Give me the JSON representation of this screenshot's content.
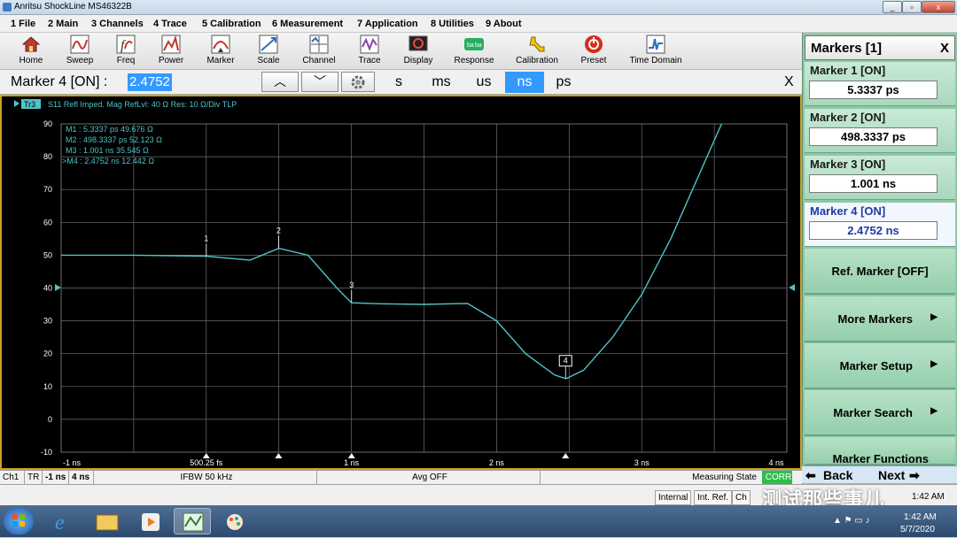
{
  "window": {
    "title": "Anritsu ShockLine MS46322B",
    "min": "_",
    "max": "▫",
    "close": "x"
  },
  "menu": [
    "1 File",
    "2 Main",
    "3 Channels",
    "4 Trace",
    "5 Calibration",
    "6 Measurement",
    "7 Application",
    "8 Utilities",
    "9 About"
  ],
  "toolbar": [
    {
      "label": "Home",
      "icon": "home-icon"
    },
    {
      "label": "Sweep",
      "icon": "sweep-icon"
    },
    {
      "label": "Freq",
      "icon": "frequency-icon"
    },
    {
      "label": "Power",
      "icon": "power-icon"
    },
    {
      "label": "Marker",
      "icon": "marker-icon"
    },
    {
      "label": "Scale",
      "icon": "scale-icon"
    },
    {
      "label": "Channel",
      "icon": "channel-icon"
    },
    {
      "label": "Trace",
      "icon": "trace-icon"
    },
    {
      "label": "Display",
      "icon": "display-icon"
    },
    {
      "label": "Response",
      "icon": "response-icon"
    },
    {
      "label": "Calibration",
      "icon": "calibration-icon"
    },
    {
      "label": "Preset",
      "icon": "preset-icon"
    },
    {
      "label": "Time Domain",
      "icon": "time-domain-icon"
    }
  ],
  "entry": {
    "label": "Marker 4 [ON]  :",
    "value": "2.4752",
    "up": "︿",
    "down": "﹀",
    "units": [
      "s",
      "ms",
      "us",
      "ns",
      "ps"
    ],
    "selected_unit": "ns",
    "close": "X"
  },
  "trace_header": {
    "tag": "Tr3",
    "text": "S11 Refl Imped. Mag RefLvl: 40  Ω Res: 10  Ω/Div  TLP"
  },
  "marker_readout": [
    "M1  :   5.3337 ps  49.676  Ω",
    "M2  :   498.3337 ps  52.123  Ω",
    "M3  :   1.001 ns  35.545  Ω",
    ">M4  :   2.4752 ns  12.442  Ω"
  ],
  "chart_data": {
    "type": "line",
    "title": "",
    "xlabel": "",
    "ylabel": "",
    "xlim": [
      -1,
      4
    ],
    "ylim": [
      -10,
      90
    ],
    "y_ticks": [
      "90",
      "80",
      "70",
      "60",
      "50",
      "40",
      "30",
      "20",
      "10",
      "0",
      "-10"
    ],
    "x_ticks": [
      "-1 ns",
      "500.25 fs",
      "1 ns",
      "2 ns",
      "3 ns",
      "4 ns"
    ],
    "reference_level": 40,
    "grid": true,
    "series": [
      {
        "color": "#4ec3c8",
        "x": [
          -1,
          -0.5,
          0,
          0.3,
          0.5,
          0.7,
          0.9,
          1.0,
          1.2,
          1.5,
          1.8,
          2.0,
          2.2,
          2.4,
          2.48,
          2.6,
          2.8,
          3.0,
          3.2,
          3.4,
          3.55
        ],
        "y": [
          50,
          50,
          49.7,
          48.5,
          52.1,
          50,
          40,
          35.5,
          35.2,
          35,
          35.3,
          30,
          20,
          13.5,
          12.4,
          15,
          25,
          38,
          55,
          75,
          90
        ]
      }
    ],
    "markers": [
      {
        "label": "1",
        "x": 0.0,
        "y": 49.676
      },
      {
        "label": "2",
        "x": 0.498,
        "y": 52.123
      },
      {
        "label": "3",
        "x": 1.001,
        "y": 35.545
      },
      {
        "label": "4",
        "x": 2.4752,
        "y": 12.442
      }
    ]
  },
  "panel": {
    "title": "Markers [1]",
    "close": "X",
    "markers": [
      {
        "label": "Marker 1 [ON]",
        "value": "5.3337 ps"
      },
      {
        "label": "Marker 2 [ON]",
        "value": "498.3337 ps"
      },
      {
        "label": "Marker 3 [ON]",
        "value": "1.001 ns"
      },
      {
        "label": "Marker 4 [ON]",
        "value": "2.4752 ns"
      }
    ],
    "softkeys": [
      "Ref. Marker [OFF]",
      "More Markers",
      "Marker Setup",
      "Marker Search",
      "Marker Functions"
    ],
    "back": "Back",
    "next": "Next"
  },
  "status": {
    "ch": "Ch1",
    "tr": "TR",
    "start": "-1 ns",
    "stop": "4 ns",
    "ifbw": "IFBW 50 kHz",
    "avg": "Avg OFF",
    "meas": "Measuring State",
    "corr": "CORR"
  },
  "status2": {
    "internal": "Internal",
    "intref": "Int. Ref.",
    "ch": "Ch",
    "time": "1:42 AM"
  },
  "taskbar": {
    "time": "1:42 AM",
    "date": "5/7/2020"
  },
  "watermark": "测试那些事儿",
  "colors": {
    "trace": "#4ec3c8",
    "grid": "#6f6f6f",
    "plot_bg": "#000000",
    "selected": "#3399ff",
    "panel": "#8fc8a6",
    "corr": "#2cbf4a"
  }
}
